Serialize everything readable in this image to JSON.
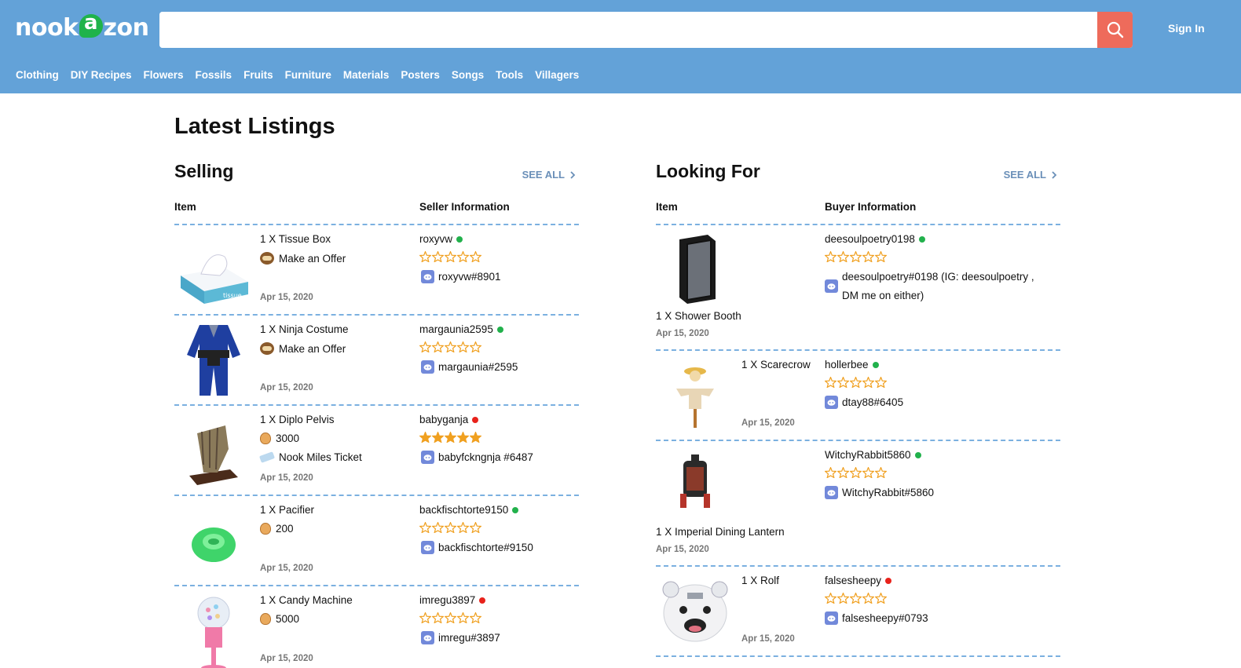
{
  "header": {
    "logo_text_a": "nook",
    "logo_leaf_letter": "a",
    "logo_text_b": "zon",
    "search_placeholder": "",
    "signin_label": "Sign In",
    "nav": [
      "Clothing",
      "DIY Recipes",
      "Flowers",
      "Fossils",
      "Fruits",
      "Furniture",
      "Materials",
      "Posters",
      "Songs",
      "Tools",
      "Villagers"
    ]
  },
  "main": {
    "title": "Latest Listings",
    "selling": {
      "title": "Selling",
      "see_all": "SEE ALL",
      "col_item": "Item",
      "col_info": "Seller Information",
      "rows": [
        {
          "name": "1 X Tissue Box",
          "price": "Make an Offer",
          "price2": "",
          "date": "Apr 15, 2020",
          "user": "roxyvw",
          "online": true,
          "stars": 0,
          "discord": "roxyvw#8901"
        },
        {
          "name": "1 X Ninja Costume",
          "price": "Make an Offer",
          "price2": "",
          "date": "Apr 15, 2020",
          "user": "margaunia2595",
          "online": true,
          "stars": 0,
          "discord": "margaunia#2595"
        },
        {
          "name": "1 X Diplo Pelvis",
          "price": "3000",
          "price2": "Nook Miles Ticket",
          "date": "Apr 15, 2020",
          "user": "babyganja",
          "online": false,
          "stars": 5,
          "discord": "babyfckngnja #6487"
        },
        {
          "name": "1 X Pacifier",
          "price": "200",
          "price2": "",
          "date": "Apr 15, 2020",
          "user": "backfischtorte9150",
          "online": true,
          "stars": 0,
          "discord": "backfischtorte#9150"
        },
        {
          "name": "1 X Candy Machine",
          "price": "5000",
          "price2": "",
          "date": "Apr 15, 2020",
          "user": "imregu3897",
          "online": false,
          "stars": 0,
          "discord": "imregu#3897"
        }
      ]
    },
    "looking": {
      "title": "Looking For",
      "see_all": "SEE ALL",
      "col_item": "Item",
      "col_info": "Buyer Information",
      "rows": [
        {
          "name": "1 X Shower Booth",
          "date": "Apr 15, 2020",
          "user": "deesoulpoetry0198",
          "online": true,
          "stars": 0,
          "discord_a": "deesoulpoetry#0198 (IG: deesoulpoetry ,",
          "discord_b": "DM me on either)"
        },
        {
          "name": "1 X Scarecrow",
          "date": "Apr 15, 2020",
          "user": "hollerbee",
          "online": true,
          "stars": 0,
          "discord_a": "dtay88#6405",
          "discord_b": ""
        },
        {
          "name": "1 X Imperial Dining Lantern",
          "date": "Apr 15, 2020",
          "user": "WitchyRabbit5860",
          "online": true,
          "stars": 0,
          "discord_a": "WitchyRabbit#5860",
          "discord_b": ""
        },
        {
          "name": "1 X Rolf",
          "date": "Apr 15, 2020",
          "user": "falsesheepy",
          "online": false,
          "stars": 0,
          "discord_a": "falsesheepy#0793",
          "discord_b": ""
        }
      ]
    }
  },
  "colors": {
    "header": "#63a2d8",
    "search_button": "#ee6b5b",
    "online": "#22b14c",
    "offline": "#e8221b",
    "star": "#f0a020",
    "discord": "#7289da"
  }
}
